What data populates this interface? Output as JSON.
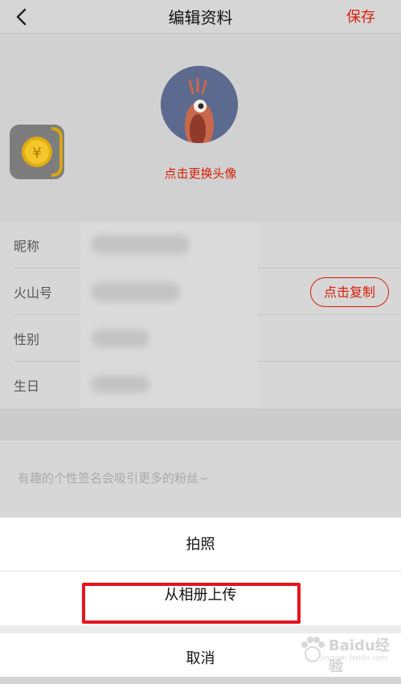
{
  "header": {
    "title": "编辑资料",
    "save_label": "保存",
    "back_icon": "chevron-left-icon"
  },
  "avatar_section": {
    "change_avatar_label": "点击更换头像",
    "coin_icon": "yuan-coin-icon"
  },
  "profile_rows": [
    {
      "label": "昵称"
    },
    {
      "label": "火山号"
    },
    {
      "label": "性别"
    },
    {
      "label": "生日"
    }
  ],
  "copy_button_label": "点击复制",
  "signature_placeholder": "有趣的个性签名会吸引更多的粉丝~",
  "action_sheet": {
    "take_photo": "拍照",
    "upload_from_album": "从相册上传",
    "cancel": "取消"
  },
  "colors": {
    "accent": "#d81e06",
    "highlight_box": "#e6141c"
  },
  "watermark": {
    "text": "Baidu经验",
    "url": "jingyan.baidu.com"
  }
}
